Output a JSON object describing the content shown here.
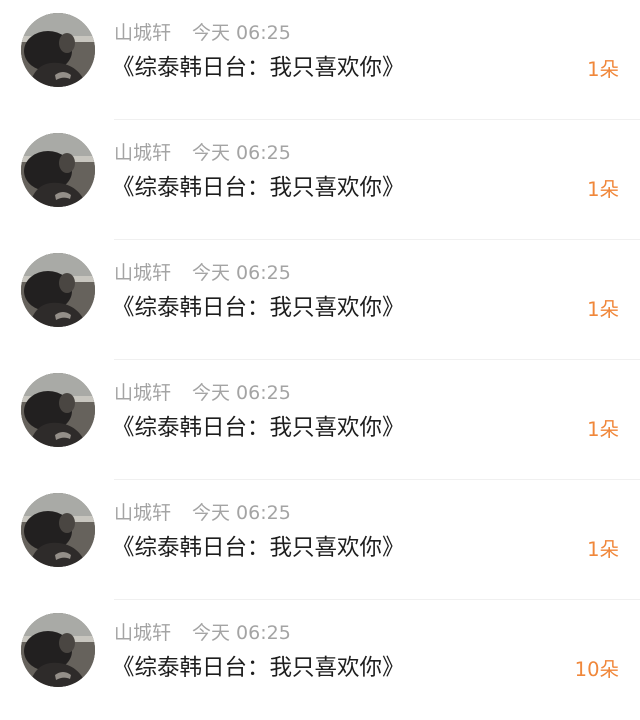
{
  "items": [
    {
      "user": "山城轩",
      "time": "今天 06:25",
      "title": "《综泰韩日台：我只喜欢你》",
      "count": "1朵"
    },
    {
      "user": "山城轩",
      "time": "今天 06:25",
      "title": "《综泰韩日台：我只喜欢你》",
      "count": "1朵"
    },
    {
      "user": "山城轩",
      "time": "今天 06:25",
      "title": "《综泰韩日台：我只喜欢你》",
      "count": "1朵"
    },
    {
      "user": "山城轩",
      "time": "今天 06:25",
      "title": "《综泰韩日台：我只喜欢你》",
      "count": "1朵"
    },
    {
      "user": "山城轩",
      "time": "今天 06:25",
      "title": "《综泰韩日台：我只喜欢你》",
      "count": "1朵"
    },
    {
      "user": "山城轩",
      "time": "今天 06:25",
      "title": "《综泰韩日台：我只喜欢你》",
      "count": "10朵"
    }
  ]
}
